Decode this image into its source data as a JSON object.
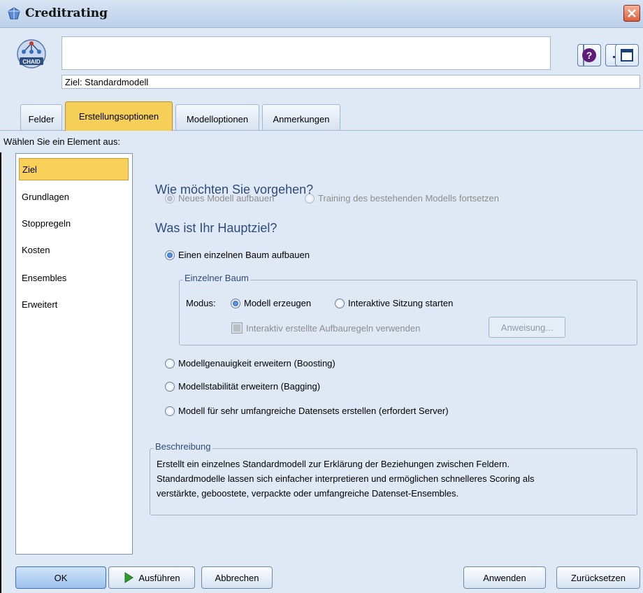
{
  "window": {
    "title": "Creditrating"
  },
  "header": {
    "node_icon_label": "CHAID",
    "name_value": "",
    "target_value": "Ziel: Standardmodell"
  },
  "tabs": [
    {
      "label": "Felder"
    },
    {
      "label": "Erstellungsoptionen"
    },
    {
      "label": "Modelloptionen"
    },
    {
      "label": "Anmerkungen"
    }
  ],
  "select_label": "Wählen Sie ein Element aus:",
  "sidebar": {
    "items": [
      {
        "label": "Ziel"
      },
      {
        "label": "Grundlagen"
      },
      {
        "label": "Stoppregeln"
      },
      {
        "label": "Kosten"
      },
      {
        "label": "Ensembles"
      },
      {
        "label": "Erweitert"
      }
    ]
  },
  "main": {
    "q1": "Wie möchten Sie vorgehen?",
    "q1_opt1": "Neues Modell aufbauen",
    "q1_opt2": "Training des bestehenden Modells fortsetzen",
    "q2": "Was ist Ihr Hauptziel?",
    "opt_single_tree": "Einen einzelnen Baum aufbauen",
    "single_tree_group": "Einzelner Baum",
    "mode_label": "Modus:",
    "mode_generate": "Modell erzeugen",
    "mode_interactive": "Interaktive Sitzung starten",
    "use_rules": "Interaktiv erstellte Aufbauregeln verwenden",
    "instruction_button": "Anweisung...",
    "opt_boosting": "Modellgenauigkeit erweitern (Boosting)",
    "opt_bagging": "Modellstabilität erweitern (Bagging)",
    "opt_large": "Modell für sehr umfangreiche Datensets erstellen (erfordert Server)"
  },
  "description": {
    "title": "Beschreibung",
    "line1": "Erstellt ein einzelnes Standardmodell zur Erklärung der Beziehungen zwischen Feldern.",
    "line2": "Standardmodelle lassen sich einfacher interpretieren und ermöglichen schnelleres Scoring als",
    "line3": "verstärkte, geboostete, verpackte oder umfangreiche Datenset-Ensembles."
  },
  "buttons": {
    "ok": "OK",
    "run": "Ausführen",
    "cancel": "Abbrechen",
    "apply": "Anwenden",
    "reset": "Zurücksetzen"
  },
  "colors": {
    "accent_tab": "#f5cf57",
    "heading": "#2e4a7b",
    "background": "#dfe9f5"
  }
}
